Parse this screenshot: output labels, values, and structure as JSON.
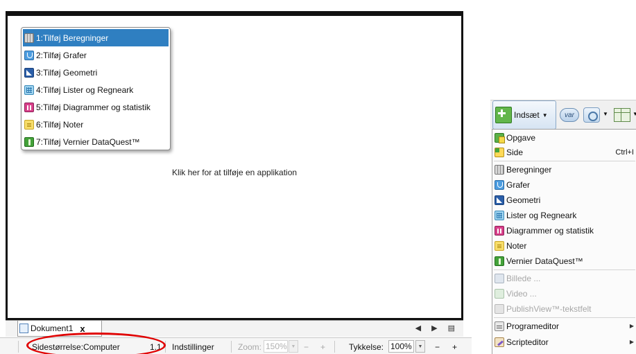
{
  "app_popup": {
    "items": [
      {
        "label": "1:Tilføj Beregninger",
        "icon": "calculator-icon",
        "selected": true
      },
      {
        "label": "2:Tilføj Grafer",
        "icon": "graphs-icon",
        "selected": false
      },
      {
        "label": "3:Tilføj Geometri",
        "icon": "geometry-icon",
        "selected": false
      },
      {
        "label": "4:Tilføj Lister og Regneark",
        "icon": "lists-spreadsheet-icon",
        "selected": false
      },
      {
        "label": "5:Tilføj Diagrammer og statistik",
        "icon": "data-statistics-icon",
        "selected": false
      },
      {
        "label": "6:Tilføj Noter",
        "icon": "notes-icon",
        "selected": false
      },
      {
        "label": "7:Tilføj Vernier DataQuest™",
        "icon": "vernier-icon",
        "selected": false
      }
    ]
  },
  "canvas": {
    "hint": "Klik her for at tilføje en applikation"
  },
  "tabbar": {
    "document_tab": "Dokument1",
    "close": "x",
    "nav": "◀ ▶ ▤"
  },
  "statusbar": {
    "page_size": "Sidestørrelse:Computer",
    "page_number": "1.1",
    "settings": "Indstillinger",
    "zoom_label": "Zoom:",
    "zoom_value": "150%",
    "zoom_minus": "−",
    "zoom_plus": "+",
    "thickness_label": "Tykkelse:",
    "thickness_value": "100%",
    "thickness_minus": "−",
    "thickness_plus": "+",
    "highlight_color": "#e00000"
  },
  "toolbar": {
    "insert_label": "Indsæt",
    "var_label": "var"
  },
  "insert_menu": {
    "items": [
      {
        "label": "Opgave",
        "shortcut": "",
        "disabled": false
      },
      {
        "label": "Side",
        "shortcut": "Ctrl+I",
        "disabled": false
      },
      {
        "label": "Beregninger",
        "shortcut": "",
        "disabled": false
      },
      {
        "label": "Grafer",
        "shortcut": "",
        "disabled": false
      },
      {
        "label": "Geometri",
        "shortcut": "",
        "disabled": false
      },
      {
        "label": "Lister og Regneark",
        "shortcut": "",
        "disabled": false
      },
      {
        "label": "Diagrammer og statistik",
        "shortcut": "",
        "disabled": false
      },
      {
        "label": "Noter",
        "shortcut": "",
        "disabled": false
      },
      {
        "label": "Vernier DataQuest™",
        "shortcut": "",
        "disabled": false
      },
      {
        "label": "Billede ...",
        "shortcut": "",
        "disabled": true
      },
      {
        "label": "Video ...",
        "shortcut": "",
        "disabled": true
      },
      {
        "label": "PublishView™-tekstfelt",
        "shortcut": "",
        "disabled": true
      },
      {
        "label": "Programeditor",
        "shortcut": "",
        "disabled": false
      },
      {
        "label": "Scripteditor",
        "shortcut": "",
        "disabled": false
      }
    ]
  }
}
